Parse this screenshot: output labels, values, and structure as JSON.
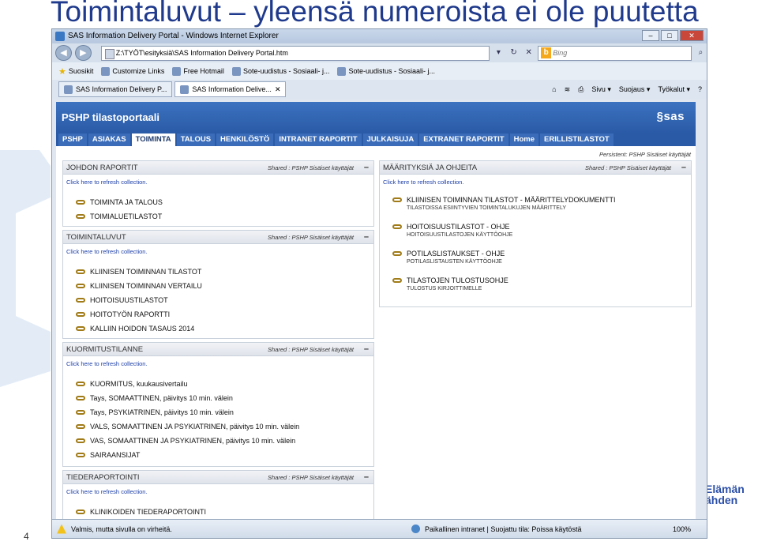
{
  "slide": {
    "title": "Toimintaluvut – yleensä numeroista ei ole puutetta",
    "number": "4",
    "brand_line1": "Elämän",
    "brand_line2": "ähden"
  },
  "browser": {
    "window_title": "SAS Information Delivery Portal - Windows Internet Explorer",
    "address": "Z:\\TYÖT\\esityksiä\\SAS Information Delivery Portal.htm",
    "search_placeholder": "Bing",
    "favorites": [
      "Suosikit",
      "Customize Links",
      "Free Hotmail",
      "Sote-uudistus - Sosiaali- j...",
      "Sote-uudistus - Sosiaali- j..."
    ],
    "tabs": [
      "SAS Information Delivery P...",
      "SAS Information Delive..."
    ],
    "commands": [
      "Sivu ▾",
      "Suojaus ▾",
      "Työkalut ▾"
    ],
    "status_text": "Valmis, mutta sivulla on virheitä.",
    "zone_text": "Paikallinen intranet | Suojattu tila: Poissa käytöstä",
    "zoom": "100%"
  },
  "portal": {
    "title": "PSHP tilastoportaali",
    "logo": "§sas",
    "nav": [
      "PSHP",
      "ASIAKAS",
      "TOIMINTA",
      "TALOUS",
      "HENKILÖSTÖ",
      "INTRANET RAPORTIT",
      "JULKAISUJA",
      "EXTRANET RAPORTIT",
      "Home",
      "ERILLISTILASTOT"
    ],
    "persistent": "Persistent: PSHP Sisäiset käyttäjät",
    "shared": "Shared : PSHP Sisäiset käyttäjät",
    "refresh": "Click here to refresh collection.",
    "panels": {
      "johdon": {
        "title": "JOHDON RAPORTIT",
        "items": [
          "TOIMINTA JA TALOUS",
          "TOIMIALUETILASTOT"
        ]
      },
      "toimintaluvut": {
        "title": "TOIMINTALUVUT",
        "items": [
          "KLIINISEN TOIMINNAN TILASTOT",
          "KLIINISEN TOIMINNAN VERTAILU",
          "HOITOISUUSTILASTOT",
          "HOITOTYÖN RAPORTTI",
          "KALLIIN HOIDON TASAUS 2014"
        ]
      },
      "kuormitus": {
        "title": "KUORMITUSTILANNE",
        "items": [
          "KUORMITUS, kuukausivertailu",
          "Tays, SOMAATTINEN, päivitys 10 min. välein",
          "Tays, PSYKIATRINEN, päivitys 10 min. välein",
          "VALS, SOMAATTINEN JA PSYKIATRINEN, päivitys 10 min. välein",
          "VAS, SOMAATTINEN JA PSYKIATRINEN, päivitys 10 min. välein",
          "SAIRAANSIJAT"
        ]
      },
      "tiede": {
        "title": "TIEDERAPORTOINTI",
        "items": [
          "KLINIKOIDEN TIEDERAPORTOINTI"
        ]
      },
      "maaritykset": {
        "title": "MÄÄRITYKSIÄ JA OHJEITA",
        "items": [
          {
            "title": "KLIINISEN TOIMINNAN TILASTOT - MÄÄRITTELYDOKUMENTTI",
            "sub": "TILASTOISSA ESIINTYVIEN TOIMINTALUKUJEN MÄÄRITTELY"
          },
          {
            "title": "HOITOISUUSTILASTOT - OHJE",
            "sub": "HOITOISUUSTILASTOJEN KÄYTTÖOHJE"
          },
          {
            "title": "POTILASLISTAUKSET - OHJE",
            "sub": "POTILASLISTAUSTEN KÄYTTÖOHJE"
          },
          {
            "title": "TILASTOJEN TULOSTUSOHJE",
            "sub": "TULOSTUS KIRJOITTIMELLE"
          }
        ]
      }
    }
  }
}
